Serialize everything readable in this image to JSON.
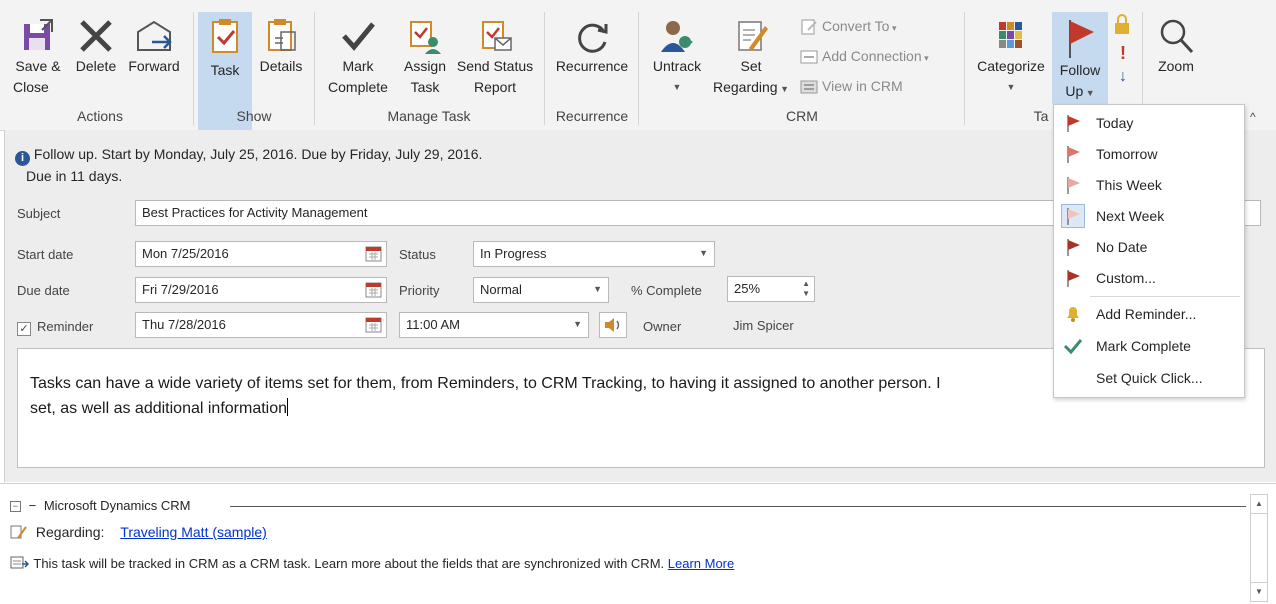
{
  "ribbon": {
    "actions": {
      "save_close_1": "Save &",
      "save_close_2": "Close",
      "delete": "Delete",
      "forward": "Forward",
      "group": "Actions"
    },
    "show": {
      "task": "Task",
      "details": "Details",
      "group": "Show"
    },
    "manage": {
      "mark_1": "Mark",
      "mark_2": "Complete",
      "assign_1": "Assign",
      "assign_2": "Task",
      "send_1": "Send Status",
      "send_2": "Report",
      "group": "Manage Task"
    },
    "recurrence": {
      "label": "Recurrence",
      "group": "Recurrence"
    },
    "crm": {
      "untrack": "Untrack",
      "set_1": "Set",
      "set_2": "Regarding",
      "convert": "Convert To",
      "add_conn": "Add Connection",
      "view": "View in CRM",
      "group": "CRM"
    },
    "tags": {
      "categorize": "Categorize",
      "follow_1": "Follow",
      "follow_2": "Up",
      "group": "Ta"
    },
    "zoom": {
      "label": "Zoom"
    }
  },
  "form": {
    "info_line_1": "Follow up.  Start by Monday, July 25, 2016.  Due by Friday, July 29, 2016.",
    "info_line_2": "Due in 11 days.",
    "subject_label": "Subject",
    "subject_value": "Best Practices for Activity Management",
    "start_label": "Start date",
    "start_value": "Mon 7/25/2016",
    "due_label": "Due date",
    "due_value": "Fri 7/29/2016",
    "reminder_label": "Reminder",
    "reminder_date": "Thu 7/28/2016",
    "reminder_time": "11:00 AM",
    "status_label": "Status",
    "status_value": "In Progress",
    "priority_label": "Priority",
    "priority_value": "Normal",
    "complete_label": "% Complete",
    "complete_value": "25%",
    "owner_label": "Owner",
    "owner_value": "Jim Spicer",
    "body_line_1": "Tasks can have a wide variety of items set for them, from Reminders, to CRM Tracking, to having it assigned to another person. I",
    "body_line_2": "set, as well as additional information"
  },
  "crm_pane": {
    "header": "Microsoft Dynamics CRM",
    "regarding_label": "Regarding:",
    "regarding_link": "Traveling Matt (sample)",
    "tracked_text": "This task will be tracked in CRM as a CRM task. Learn more about the fields that are synchronized with CRM.",
    "learn_more": "Learn More"
  },
  "followup_menu": {
    "items": [
      "Today",
      "Tomorrow",
      "This Week",
      "Next Week",
      "No Date",
      "Custom...",
      "Add Reminder...",
      "Mark Complete",
      "Set Quick Click..."
    ]
  },
  "colors": {
    "accent": "#2b579a",
    "flag": "#c0392b",
    "selected": "#c5d9ef",
    "check": "#3c8c6c"
  }
}
